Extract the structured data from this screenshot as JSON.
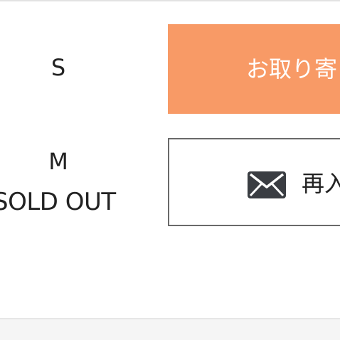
{
  "sizes": [
    {
      "label": "S",
      "action": {
        "label": "お取り寄"
      }
    },
    {
      "label": "M",
      "status": "SOLD OUT",
      "action": {
        "label": "再入",
        "icon": "envelope-icon"
      }
    }
  ],
  "colors": {
    "order_button_bg": "#f89a66",
    "order_button_text": "#ffffff",
    "restock_button_border": "#6a6a6a",
    "text": "#222222"
  }
}
